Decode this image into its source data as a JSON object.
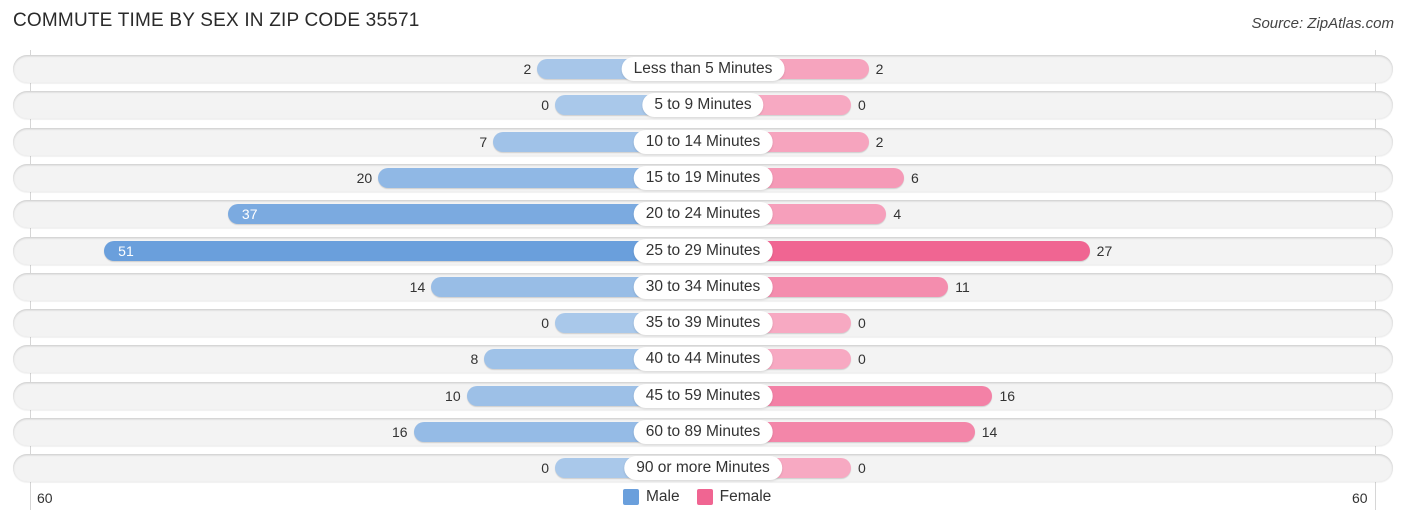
{
  "chart_data": {
    "type": "bar",
    "orientation": "horizontal-diverging",
    "title": "COMMUTE TIME BY SEX IN ZIP CODE 35571",
    "source": "Source: ZipAtlas.com",
    "categories": [
      "Less than 5 Minutes",
      "5 to 9 Minutes",
      "10 to 14 Minutes",
      "15 to 19 Minutes",
      "20 to 24 Minutes",
      "25 to 29 Minutes",
      "30 to 34 Minutes",
      "35 to 39 Minutes",
      "40 to 44 Minutes",
      "45 to 59 Minutes",
      "60 to 89 Minutes",
      "90 or more Minutes"
    ],
    "series": [
      {
        "name": "Male",
        "color": "#6a9fdc",
        "values": [
          2,
          0,
          7,
          20,
          37,
          51,
          14,
          0,
          8,
          10,
          16,
          0
        ]
      },
      {
        "name": "Female",
        "color": "#f06592",
        "values": [
          2,
          0,
          2,
          6,
          4,
          27,
          11,
          0,
          0,
          16,
          14,
          0
        ]
      }
    ],
    "axis": {
      "left_label": "60",
      "right_label": "60",
      "max": 60
    },
    "legend": {
      "position": "bottom-center",
      "entries": [
        "Male",
        "Female"
      ]
    },
    "grid": false
  },
  "colors": {
    "male_light": "#a9c8ea",
    "male_dark": "#6a9fdc",
    "female_light": "#f7a9c2",
    "female_dark": "#f06592"
  }
}
